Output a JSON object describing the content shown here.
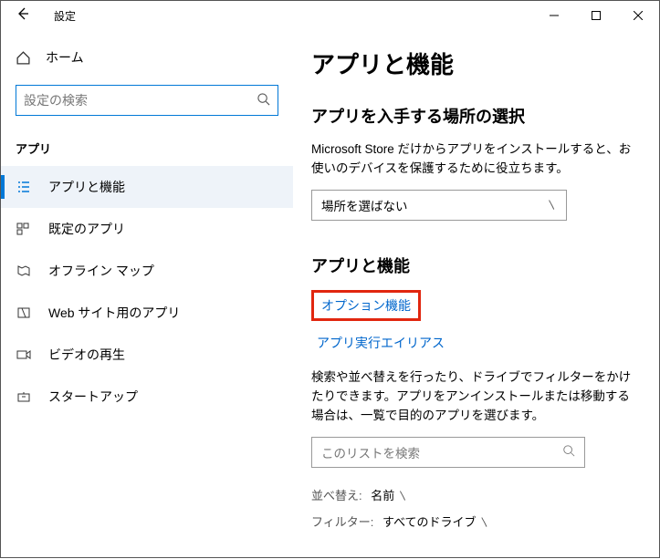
{
  "titlebar": {
    "title": "設定"
  },
  "sidebar": {
    "home": "ホーム",
    "search_placeholder": "設定の検索",
    "section": "アプリ",
    "items": [
      {
        "label": "アプリと機能"
      },
      {
        "label": "既定のアプリ"
      },
      {
        "label": "オフライン マップ"
      },
      {
        "label": "Web サイト用のアプリ"
      },
      {
        "label": "ビデオの再生"
      },
      {
        "label": "スタートアップ"
      }
    ]
  },
  "content": {
    "page_title": "アプリと機能",
    "source_heading": "アプリを入手する場所の選択",
    "source_desc": "Microsoft Store だけからアプリをインストールすると、お使いのデバイスを保護するために役立ちます。",
    "source_select": "場所を選ばない",
    "apps_heading": "アプリと機能",
    "link_optional": "オプション機能",
    "link_alias": "アプリ実行エイリアス",
    "apps_desc": "検索や並べ替えを行ったり、ドライブでフィルターをかけたりできます。アプリをアンインストールまたは移動する場合は、一覧で目的のアプリを選びます。",
    "search_placeholder": "このリストを検索",
    "sort_label": "並べ替え:",
    "sort_value": "名前",
    "filter_label": "フィルター:",
    "filter_value": "すべてのドライブ"
  }
}
